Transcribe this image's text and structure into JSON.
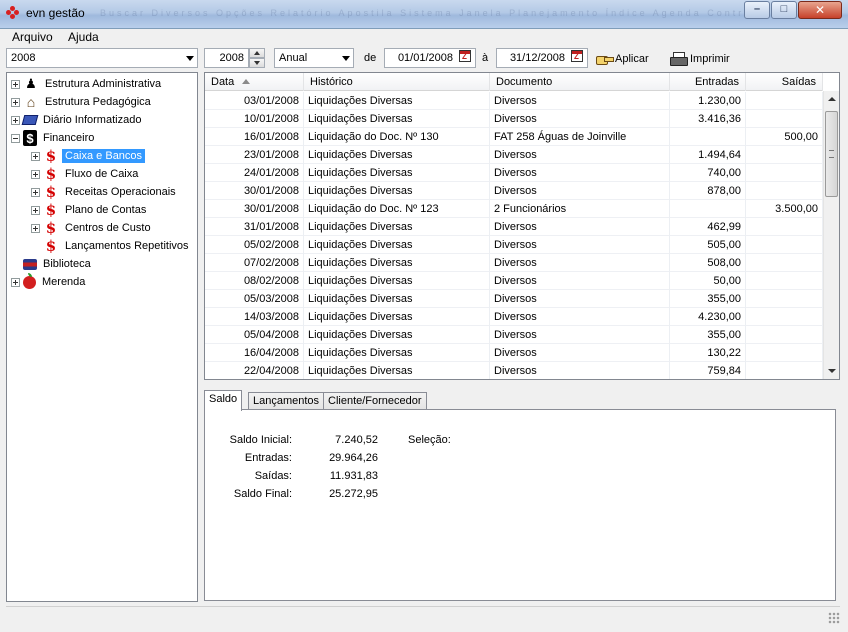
{
  "window": {
    "title": "evn gestão",
    "ghost_toolbar": "Buscar  Diversos  Opções  Relatório  Apostila  Sistema  Janela  Planejamento  Índice  Agenda  Controle"
  },
  "menu": [
    "Arquivo",
    "Ajuda"
  ],
  "toolbar": {
    "year_select": "2008",
    "year_spin": "2008",
    "period": "Anual",
    "de_label": "de",
    "date_from": "01/01/2008",
    "a_label": "à",
    "date_to": "31/12/2008",
    "apply_label": "Aplicar",
    "print_label": "Imprimir"
  },
  "tree": [
    {
      "label": "Estrutura Administrativa",
      "icon": "org-icon",
      "expander": "plus",
      "level": 0
    },
    {
      "label": "Estrutura Pedagógica",
      "icon": "school-icon",
      "expander": "plus",
      "level": 0
    },
    {
      "label": "Diário Informatizado",
      "icon": "book-icon",
      "expander": "plus",
      "level": 0
    },
    {
      "label": "Financeiro",
      "icon": "dollar-box-icon",
      "expander": "minus",
      "level": 0
    },
    {
      "label": "Caixa e Bancos",
      "icon": "dollar-icon",
      "expander": "plus",
      "level": 1,
      "selected": true
    },
    {
      "label": "Fluxo de Caixa",
      "icon": "dollar-icon",
      "expander": "plus",
      "level": 1
    },
    {
      "label": "Receitas Operacionais",
      "icon": "dollar-icon",
      "expander": "plus",
      "level": 1
    },
    {
      "label": "Plano de Contas",
      "icon": "dollar-icon",
      "expander": "plus",
      "level": 1
    },
    {
      "label": "Centros de Custo",
      "icon": "dollar-icon",
      "expander": "plus",
      "level": 1
    },
    {
      "label": "Lançamentos Repetitivos",
      "icon": "dollar-icon",
      "expander": "none",
      "level": 1
    },
    {
      "label": "Biblioteca",
      "icon": "library-icon",
      "expander": "none",
      "level": 0
    },
    {
      "label": "Merenda",
      "icon": "apple-icon",
      "expander": "plus",
      "level": 0
    }
  ],
  "grid": {
    "columns": [
      "Data",
      "Histórico",
      "Documento",
      "Entradas",
      "Saídas"
    ],
    "rows": [
      [
        "03/01/2008",
        "Liquidações Diversas",
        "Diversos",
        "1.230,00",
        ""
      ],
      [
        "10/01/2008",
        "Liquidações Diversas",
        "Diversos",
        "3.416,36",
        ""
      ],
      [
        "16/01/2008",
        "Liquidação do Doc. Nº 130",
        "FAT 258 Águas de Joinville",
        "",
        "500,00"
      ],
      [
        "23/01/2008",
        "Liquidações Diversas",
        "Diversos",
        "1.494,64",
        ""
      ],
      [
        "24/01/2008",
        "Liquidações Diversas",
        "Diversos",
        "740,00",
        ""
      ],
      [
        "30/01/2008",
        "Liquidações Diversas",
        "Diversos",
        "878,00",
        ""
      ],
      [
        "30/01/2008",
        "Liquidação do Doc. Nº 123",
        "2 Funcionários",
        "",
        "3.500,00"
      ],
      [
        "31/01/2008",
        "Liquidações Diversas",
        "Diversos",
        "462,99",
        ""
      ],
      [
        "05/02/2008",
        "Liquidações Diversas",
        "Diversos",
        "505,00",
        ""
      ],
      [
        "07/02/2008",
        "Liquidações Diversas",
        "Diversos",
        "508,00",
        ""
      ],
      [
        "08/02/2008",
        "Liquidações Diversas",
        "Diversos",
        "50,00",
        ""
      ],
      [
        "05/03/2008",
        "Liquidações Diversas",
        "Diversos",
        "355,00",
        ""
      ],
      [
        "14/03/2008",
        "Liquidações Diversas",
        "Diversos",
        "4.230,00",
        ""
      ],
      [
        "05/04/2008",
        "Liquidações Diversas",
        "Diversos",
        "355,00",
        ""
      ],
      [
        "16/04/2008",
        "Liquidações Diversas",
        "Diversos",
        "130,22",
        ""
      ],
      [
        "22/04/2008",
        "Liquidações Diversas",
        "Diversos",
        "759,84",
        ""
      ]
    ]
  },
  "tabs": [
    "Saldo",
    "Lançamentos",
    "Cliente/Fornecedor"
  ],
  "saldo": {
    "saldo_inicial_label": "Saldo Inicial:",
    "saldo_inicial": "7.240,52",
    "entradas_label": "Entradas:",
    "entradas": "29.964,26",
    "saidas_label": "Saídas:",
    "saidas": "11.931,83",
    "saldo_final_label": "Saldo Final:",
    "saldo_final": "25.272,95",
    "selecao_label": "Seleção:"
  }
}
